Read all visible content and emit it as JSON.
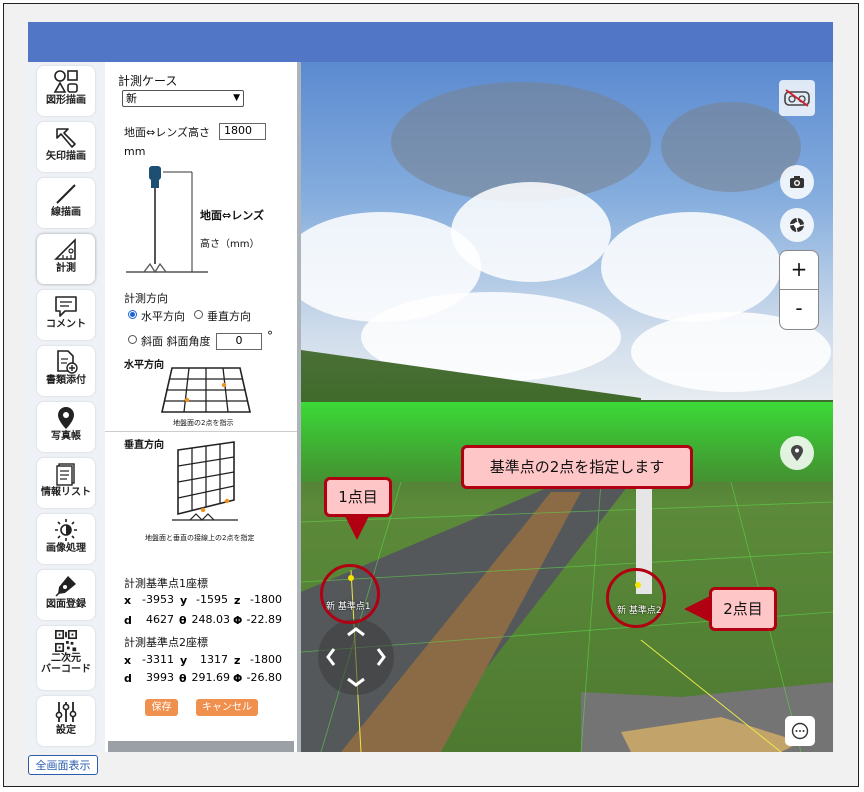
{
  "toolbar": {
    "items": [
      {
        "label": "図形描画",
        "icon": "shapes-icon"
      },
      {
        "label": "矢印描画",
        "icon": "arrow-icon"
      },
      {
        "label": "線描画",
        "icon": "line-icon"
      },
      {
        "label": "計測",
        "icon": "measure-icon"
      },
      {
        "label": "コメント",
        "icon": "comment-icon"
      },
      {
        "label": "書類添付",
        "icon": "document-attach-icon"
      },
      {
        "label": "写真帳",
        "icon": "location-pin-icon"
      },
      {
        "label": "情報リスト",
        "icon": "info-list-icon"
      },
      {
        "label": "画像処理",
        "icon": "brightness-icon"
      },
      {
        "label": "図面登録",
        "icon": "pen-nib-icon"
      },
      {
        "label": "二次元",
        "label2": "バーコード",
        "icon": "qr-code-icon"
      },
      {
        "label": "設定",
        "icon": "sliders-icon"
      }
    ]
  },
  "panel": {
    "case_label": "計測ケース",
    "case_value": "新",
    "height_label": "地面⇔レンズ高さ",
    "height_value": "1800",
    "height_unit": "mm",
    "diagram_label1": "地面⇔レンズ",
    "diagram_label2": "高さ（mm）",
    "direction_label": "計測方向",
    "radio_horizontal": "水平方向",
    "radio_vertical": "垂直方向",
    "radio_slope": "斜面 斜面角度",
    "slope_angle": "0",
    "degree_symbol": "°",
    "horizontal_title": "水平方向",
    "horizontal_caption": "地盤面の2点を指示",
    "vertical_title": "垂直方向",
    "vertical_caption": "地盤面と垂直の接線上の2点を指定",
    "point1_title": "計測基準点1座標",
    "point1": {
      "x": "-3953",
      "y": "-1595",
      "z": "-1800",
      "d": "4627",
      "theta": "248.03",
      "phi": "-22.89"
    },
    "point2_title": "計測基準点2座標",
    "point2": {
      "x": "-3311",
      "y": "1317",
      "z": "-1800",
      "d": "3993",
      "theta": "291.69",
      "phi": "-26.80"
    },
    "labels": {
      "x": "x",
      "y": "y",
      "z": "z",
      "d": "d",
      "theta": "θ",
      "phi": "Φ"
    },
    "save_label": "保存",
    "cancel_label": "キャンセル"
  },
  "viewer": {
    "callout_main": "基準点の2点を指定します",
    "callout_p1": "1点目",
    "callout_p2": "2点目",
    "marker1_label": "新 基準点1",
    "marker2_label": "新 基準点2",
    "zoom_in": "+",
    "zoom_out": "-"
  },
  "footer": {
    "fullscreen_label": "全画面表示"
  },
  "colors": {
    "topbar": "#5276c6",
    "accent_red": "#b00012",
    "orange_button": "#f0904e"
  }
}
